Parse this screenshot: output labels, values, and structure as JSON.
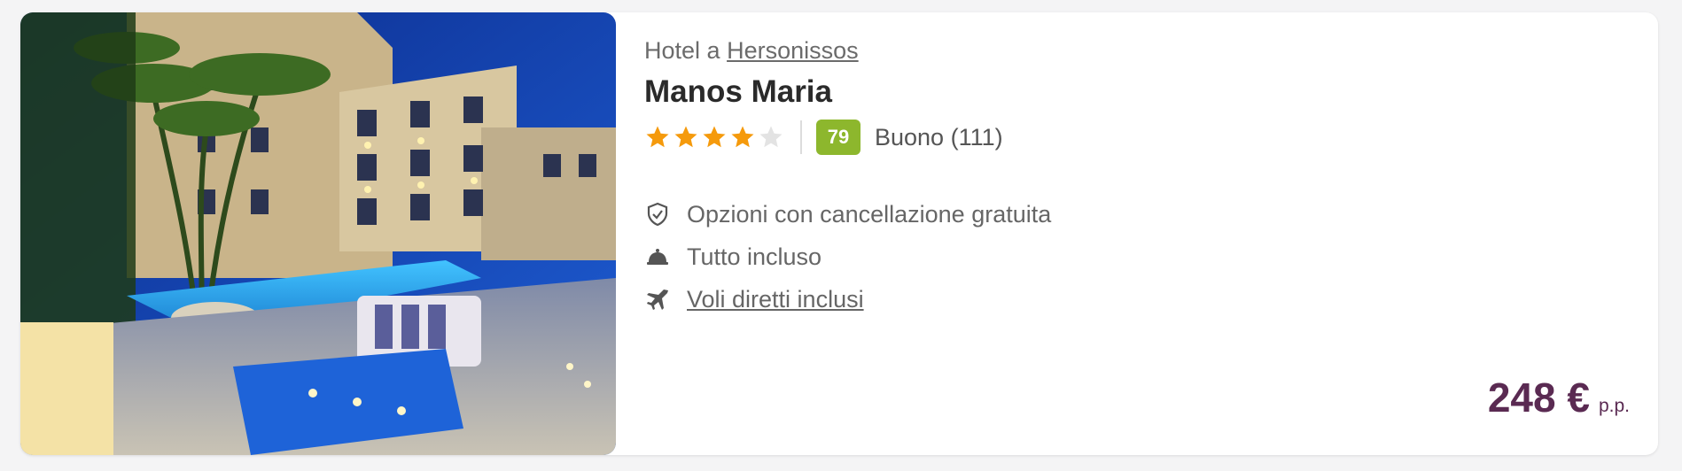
{
  "hotel": {
    "location_prefix": "Hotel a",
    "location_link": "Hersonissos",
    "name": "Manos Maria",
    "stars": 4,
    "max_stars": 5,
    "score": "79",
    "score_label": "Buono (111)",
    "photo_icon": "hotel-photo"
  },
  "features": [
    {
      "icon": "shield-check-icon",
      "label": "Opzioni con cancellazione gratuita",
      "link": false
    },
    {
      "icon": "service-bell-icon",
      "label": "Tutto incluso",
      "link": false
    },
    {
      "icon": "airplane-icon",
      "label": "Voli diretti inclusi",
      "link": true
    }
  ],
  "price": {
    "amount": "248 €",
    "unit": "p.p."
  },
  "colors": {
    "star": "#f59a0c",
    "star_empty": "#e3e3e3",
    "score_bg": "#8db72d",
    "price": "#5a2a52",
    "text_muted": "#6b6b6b"
  }
}
